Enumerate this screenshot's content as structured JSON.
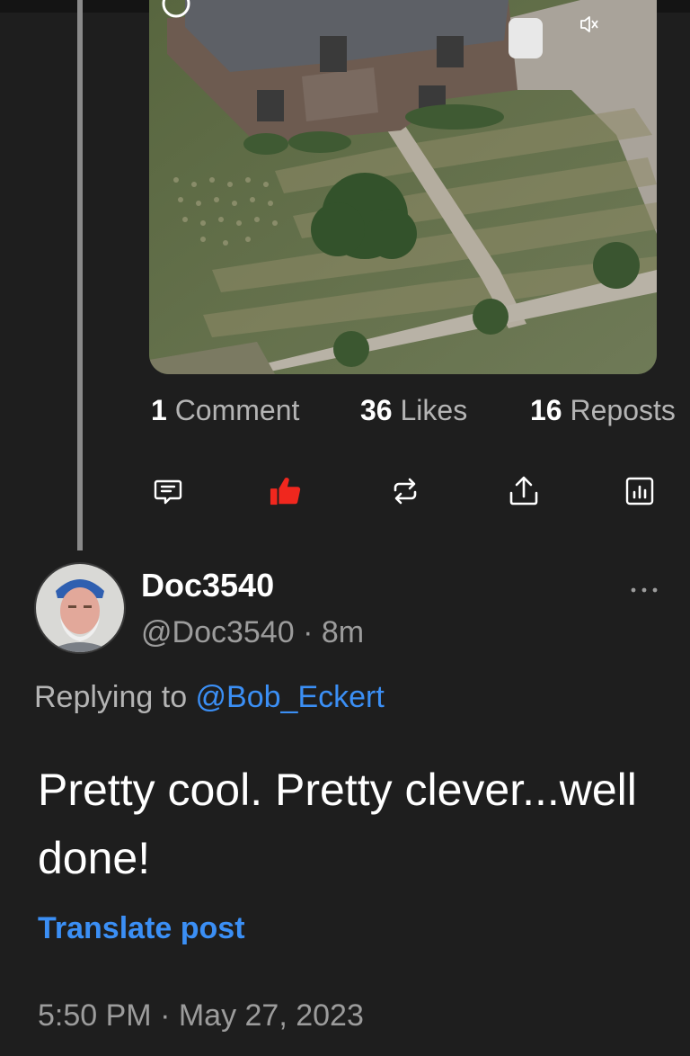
{
  "media": {
    "image_description_icon": "mute-icon"
  },
  "stats": {
    "comments": {
      "count": "1",
      "label": "Comment"
    },
    "likes": {
      "count": "36",
      "label": "Likes"
    },
    "reposts": {
      "count": "16",
      "label": "Reposts"
    }
  },
  "actions": {
    "comment_icon": "comment-icon",
    "like_icon": "thumbs-up-icon",
    "repost_icon": "repost-icon",
    "share_icon": "share-icon",
    "analytics_icon": "analytics-icon",
    "like_color": "#f0271e"
  },
  "reply": {
    "display_name": "Doc3540",
    "handle": "@Doc3540",
    "separator": " · ",
    "time_ago": "8m",
    "replying_prefix": "Replying to ",
    "replying_to": "@Bob_Eckert",
    "text": "Pretty cool. Pretty clever...well done!",
    "translate_label": "Translate post",
    "timestamp": "5:50 PM · May 27, 2023"
  },
  "colors": {
    "background": "#1e1e1e",
    "link": "#3b8ff5",
    "muted_text": "#9c9c9c"
  }
}
